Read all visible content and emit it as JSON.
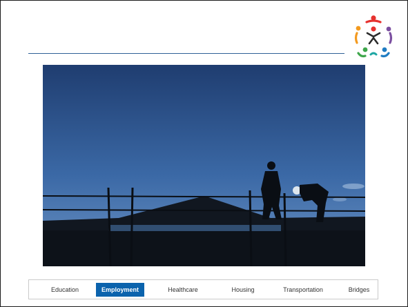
{
  "slide": {
    "logo_icon": "community-figures-logo-icon",
    "photo_icon": "construction-workers-silhouette-photo"
  },
  "colors": {
    "header_rule": "#2e5f95",
    "active_tab_bg": "#0b63ad",
    "logo_red": "#e6312e",
    "logo_orange": "#f39a1f",
    "logo_purple": "#7b4fa0",
    "logo_blue": "#1f7cc2",
    "logo_green": "#3ea64b",
    "logo_teal": "#1fa7a4"
  },
  "nav": {
    "active_index": 1,
    "tabs": [
      {
        "label": "Education"
      },
      {
        "label": "Employment"
      },
      {
        "label": "Healthcare"
      },
      {
        "label": "Housing"
      },
      {
        "label": "Transportation"
      },
      {
        "label": "Bridges"
      }
    ]
  }
}
